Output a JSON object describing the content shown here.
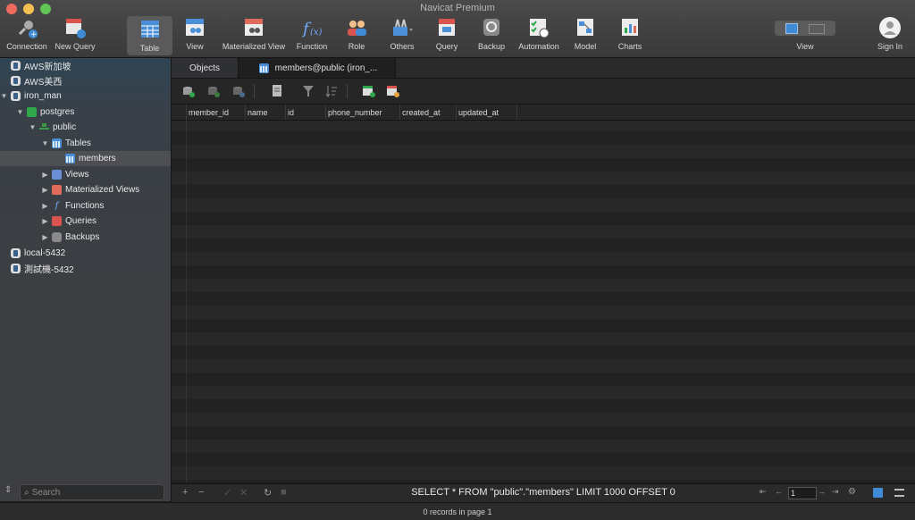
{
  "window": {
    "title": "Navicat Premium"
  },
  "toolbar": {
    "items": [
      {
        "label": "Connection",
        "icon": "connection-icon"
      },
      {
        "label": "New Query",
        "icon": "new-query-icon"
      },
      {
        "label": "Table",
        "icon": "table-icon",
        "active": true
      },
      {
        "label": "View",
        "icon": "view-icon"
      },
      {
        "label": "Materialized View",
        "icon": "materialized-view-icon"
      },
      {
        "label": "Function",
        "icon": "function-icon"
      },
      {
        "label": "Role",
        "icon": "role-icon"
      },
      {
        "label": "Others",
        "icon": "others-icon"
      },
      {
        "label": "Query",
        "icon": "query-icon"
      },
      {
        "label": "Backup",
        "icon": "backup-icon"
      },
      {
        "label": "Automation",
        "icon": "automation-icon"
      },
      {
        "label": "Model",
        "icon": "model-icon"
      },
      {
        "label": "Charts",
        "icon": "charts-icon"
      }
    ],
    "view_label": "View",
    "signin_label": "Sign In"
  },
  "sidebar": {
    "items": [
      {
        "label": "AWS新加坡",
        "icon": "server-icon"
      },
      {
        "label": "AWS美西",
        "icon": "server-icon"
      },
      {
        "label": "iron_man",
        "icon": "server-icon"
      },
      {
        "label": "postgres",
        "icon": "database-icon"
      },
      {
        "label": "public",
        "icon": "schema-icon"
      },
      {
        "label": "Tables",
        "icon": "tables-icon"
      },
      {
        "label": "members",
        "icon": "table-icon"
      },
      {
        "label": "Views",
        "icon": "views-icon"
      },
      {
        "label": "Materialized Views",
        "icon": "materialized-views-icon"
      },
      {
        "label": "Functions",
        "icon": "functions-icon"
      },
      {
        "label": "Queries",
        "icon": "queries-icon"
      },
      {
        "label": "Backups",
        "icon": "backups-icon"
      },
      {
        "label": "local-5432",
        "icon": "server-icon"
      },
      {
        "label": "測試機-5432",
        "icon": "server-icon"
      }
    ],
    "search_placeholder": "Search"
  },
  "tabs": {
    "objects": "Objects",
    "members": "members@public (iron_..."
  },
  "grid": {
    "columns": [
      "member_id",
      "name",
      "id",
      "phone_number",
      "created_at",
      "updated_at"
    ]
  },
  "footer": {
    "sql": "SELECT * FROM \"public\".\"members\" LIMIT 1000 OFFSET 0",
    "page": "1"
  },
  "status": {
    "text": "0 records in page 1"
  }
}
